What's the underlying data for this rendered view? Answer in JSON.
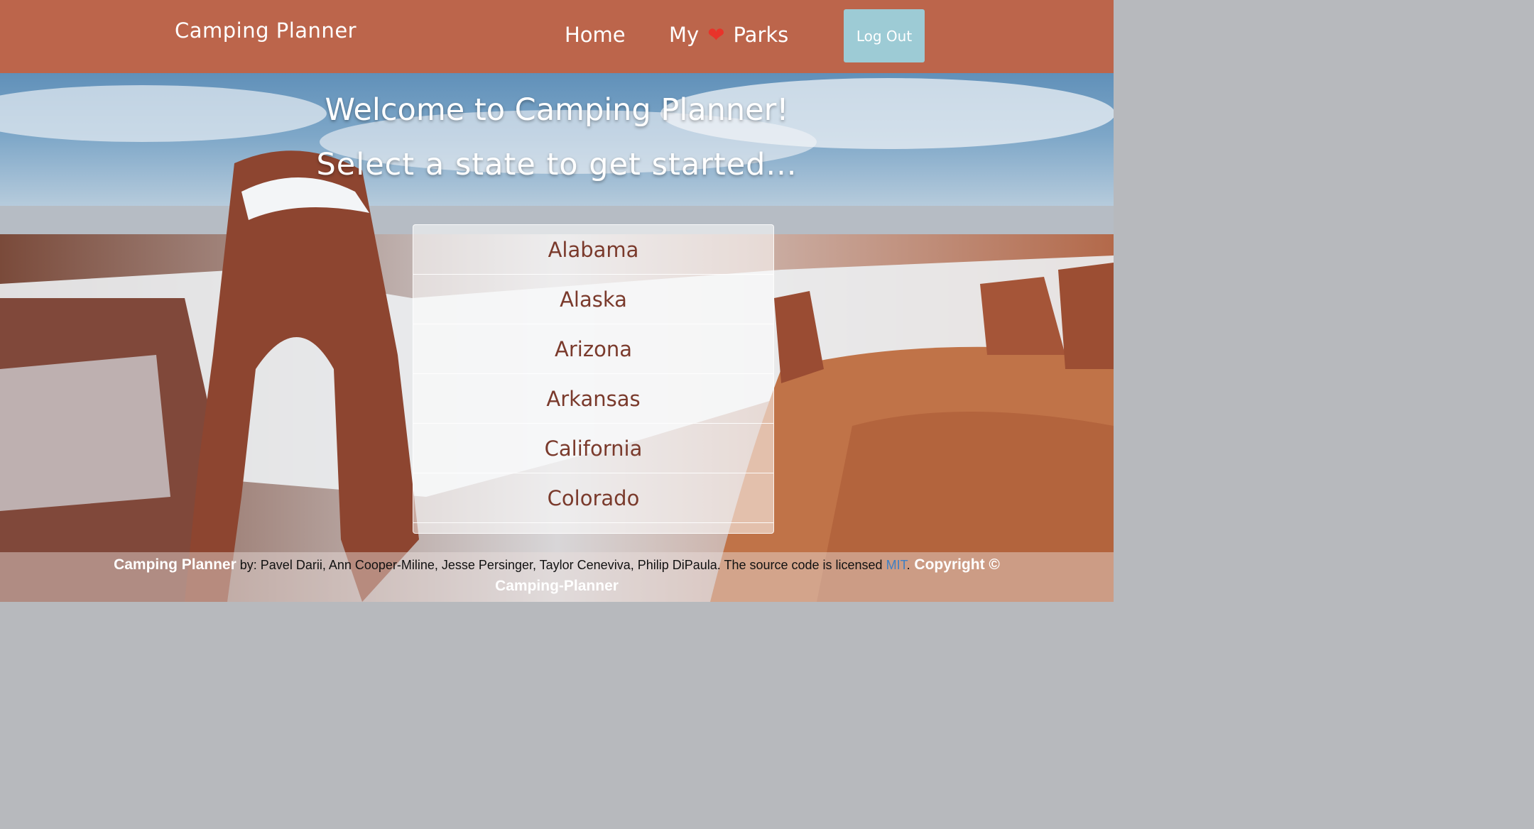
{
  "navbar": {
    "brand": "Camping Planner",
    "home_label": "Home",
    "my_label": "My",
    "parks_label": "Parks",
    "heart_icon": "heart-icon",
    "logout_label": "Log Out",
    "bg_color": "#bc654b",
    "logout_color": "#9dcbd5"
  },
  "hero": {
    "welcome": "Welcome to Camping Planner!",
    "subtitle": "Select a state to get started..."
  },
  "states": [
    "Alabama",
    "Alaska",
    "Arizona",
    "Arkansas",
    "California",
    "Colorado"
  ],
  "footer": {
    "brand": "Camping Planner",
    "text": " by: Pavel Darii, Ann Cooper-Miline, Jesse Persinger, Taylor Ceneviva, Philip DiPaula. The source code is licensed ",
    "license": "MIT",
    "period": ".",
    "copyright": " Copyright © Camping-Planner"
  }
}
